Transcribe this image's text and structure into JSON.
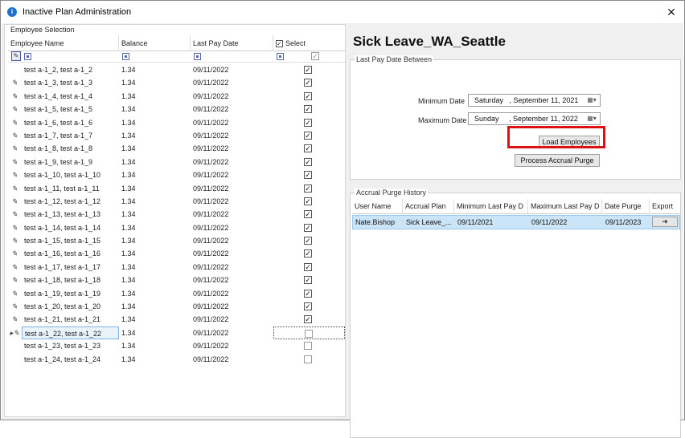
{
  "window": {
    "title": "Inactive Plan Administration",
    "close_glyph": "✕",
    "app_icon": "info-circle-icon"
  },
  "employee_selection": {
    "group_label": "Employee Selection",
    "columns": {
      "name": "Employee Name",
      "balance": "Balance",
      "last_pay_date": "Last Pay Date",
      "select": "Select"
    },
    "select_all_checked": true,
    "rows": [
      {
        "name": "test a-1_2, test a-1_2",
        "balance": "1.34",
        "date": "09/11/2022",
        "checked": true,
        "indicator": ""
      },
      {
        "name": "test a-1_3, test a-1_3",
        "balance": "1.34",
        "date": "09/11/2022",
        "checked": true,
        "indicator": "✎"
      },
      {
        "name": "test a-1_4, test a-1_4",
        "balance": "1.34",
        "date": "09/11/2022",
        "checked": true,
        "indicator": "✎"
      },
      {
        "name": "test a-1_5, test a-1_5",
        "balance": "1.34",
        "date": "09/11/2022",
        "checked": true,
        "indicator": "✎"
      },
      {
        "name": "test a-1_6, test a-1_6",
        "balance": "1.34",
        "date": "09/11/2022",
        "checked": true,
        "indicator": "✎"
      },
      {
        "name": "test a-1_7, test a-1_7",
        "balance": "1.34",
        "date": "09/11/2022",
        "checked": true,
        "indicator": "✎"
      },
      {
        "name": "test a-1_8, test a-1_8",
        "balance": "1.34",
        "date": "09/11/2022",
        "checked": true,
        "indicator": "✎"
      },
      {
        "name": "test a-1_9, test a-1_9",
        "balance": "1.34",
        "date": "09/11/2022",
        "checked": true,
        "indicator": "✎"
      },
      {
        "name": "test a-1_10, test a-1_10",
        "balance": "1.34",
        "date": "09/11/2022",
        "checked": true,
        "indicator": "✎"
      },
      {
        "name": "test a-1_11, test a-1_11",
        "balance": "1.34",
        "date": "09/11/2022",
        "checked": true,
        "indicator": "✎"
      },
      {
        "name": "test a-1_12, test a-1_12",
        "balance": "1.34",
        "date": "09/11/2022",
        "checked": true,
        "indicator": "✎"
      },
      {
        "name": "test a-1_13, test a-1_13",
        "balance": "1.34",
        "date": "09/11/2022",
        "checked": true,
        "indicator": "✎"
      },
      {
        "name": "test a-1_14, test a-1_14",
        "balance": "1.34",
        "date": "09/11/2022",
        "checked": true,
        "indicator": "✎"
      },
      {
        "name": "test a-1_15, test a-1_15",
        "balance": "1.34",
        "date": "09/11/2022",
        "checked": true,
        "indicator": "✎"
      },
      {
        "name": "test a-1_16, test a-1_16",
        "balance": "1.34",
        "date": "09/11/2022",
        "checked": true,
        "indicator": "✎"
      },
      {
        "name": "test a-1_17, test a-1_17",
        "balance": "1.34",
        "date": "09/11/2022",
        "checked": true,
        "indicator": "✎"
      },
      {
        "name": "test a-1_18, test a-1_18",
        "balance": "1.34",
        "date": "09/11/2022",
        "checked": true,
        "indicator": "✎"
      },
      {
        "name": "test a-1_19, test a-1_19",
        "balance": "1.34",
        "date": "09/11/2022",
        "checked": true,
        "indicator": "✎"
      },
      {
        "name": "test a-1_20, test a-1_20",
        "balance": "1.34",
        "date": "09/11/2022",
        "checked": true,
        "indicator": "✎"
      },
      {
        "name": "test a-1_21, test a-1_21",
        "balance": "1.34",
        "date": "09/11/2022",
        "checked": true,
        "indicator": "✎"
      },
      {
        "name": "test a-1_22, test a-1_22",
        "balance": "1.34",
        "date": "09/11/2022",
        "checked": false,
        "indicator": "▸✎",
        "selected": true
      },
      {
        "name": "test a-1_23, test a-1_23",
        "balance": "1.34",
        "date": "09/11/2022",
        "checked": false,
        "indicator": ""
      },
      {
        "name": "test a-1_24, test a-1_24",
        "balance": "1.34",
        "date": "09/11/2022",
        "checked": false,
        "indicator": ""
      }
    ]
  },
  "plan": {
    "title": "Sick Leave_WA_Seattle"
  },
  "last_pay_date": {
    "group_label": "Last Pay Date Between",
    "min_label": "Minimum Date",
    "min_value": "Saturday   , September 11, 2021",
    "max_label": "Maximum Date",
    "max_value": "Sunday     , September 11, 2022",
    "load_button": "Load Employees",
    "process_button": "Process Accrual Purge",
    "highlight_color": "#dd1111"
  },
  "purge_history": {
    "group_label": "Accrual Purge History",
    "columns": [
      "User Name",
      "Accrual Plan",
      "Minimum Last Pay D",
      "Maximum Last Pay D",
      "Date Purge",
      "Export"
    ],
    "rows": [
      {
        "user": "Nate.Bishop",
        "plan": "Sick Leave_...",
        "min": "09/11/2021",
        "max": "09/11/2022",
        "purge": "09/11/2023",
        "export": "➜"
      }
    ]
  }
}
